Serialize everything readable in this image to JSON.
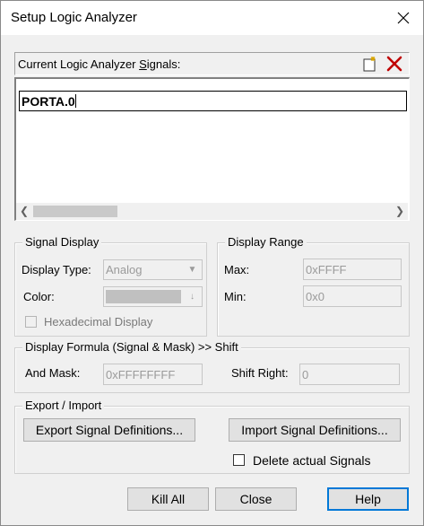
{
  "window": {
    "title": "Setup Logic Analyzer"
  },
  "signals": {
    "header_label": "Current Logic Analyzer Signals:",
    "new_icon": "new-signal-icon",
    "delete_icon": "delete-signal-icon",
    "edit_value": "PORTA.0"
  },
  "signal_display": {
    "title": "Signal Display",
    "display_type_label": "Display Type:",
    "display_type_value": "Analog",
    "color_label": "Color:",
    "hex_label": "Hexadecimal Display"
  },
  "display_range": {
    "title": "Display Range",
    "max_label": "Max:",
    "max_value": "0xFFFF",
    "min_label": "Min:",
    "min_value": "0x0"
  },
  "formula": {
    "title": "Display Formula (Signal & Mask) >> Shift",
    "and_mask_label": "And Mask:",
    "and_mask_value": "0xFFFFFFFF",
    "shift_label": "Shift Right:",
    "shift_value": "0"
  },
  "export_import": {
    "title": "Export / Import",
    "export_label": "Export Signal Definitions...",
    "import_label": "Import Signal Definitions...",
    "delete_label": "Delete actual Signals"
  },
  "buttons": {
    "kill_all": "Kill All",
    "close": "Close",
    "help": "Help"
  },
  "colors": {
    "accent": "#0078d7",
    "delete_icon": "#c00000",
    "swatch": "#c0c0c0"
  }
}
